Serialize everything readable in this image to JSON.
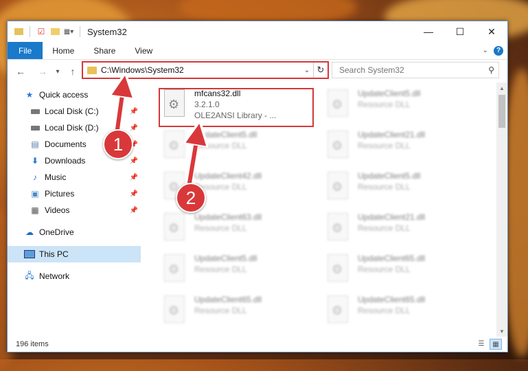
{
  "titlebar": {
    "title": "System32",
    "minimize": "—",
    "maximize": "☐",
    "close": "✕"
  },
  "ribbon": {
    "tabs": [
      "File",
      "Home",
      "Share",
      "View"
    ],
    "help": "?"
  },
  "navbar": {
    "back": "←",
    "forward": "→",
    "recent": "▾",
    "up": "↑",
    "address": "C:\\Windows\\System32",
    "search_placeholder": "Search System32"
  },
  "sidebar": {
    "items": [
      {
        "label": "Quick access",
        "icon": "star-icon"
      },
      {
        "label": "Local Disk (C:)",
        "icon": "drive-icon"
      },
      {
        "label": "Local Disk (D:)",
        "icon": "drive-icon"
      },
      {
        "label": "Documents",
        "icon": "documents-icon"
      },
      {
        "label": "Downloads",
        "icon": "download-icon"
      },
      {
        "label": "Music",
        "icon": "music-icon"
      },
      {
        "label": "Pictures",
        "icon": "pictures-icon"
      },
      {
        "label": "Videos",
        "icon": "video-icon"
      },
      {
        "label": "OneDrive",
        "icon": "cloud-icon"
      },
      {
        "label": "This PC",
        "icon": "computer-icon"
      },
      {
        "label": "Network",
        "icon": "network-icon"
      }
    ]
  },
  "files": {
    "selected": {
      "name": "mfcans32.dll",
      "version": "3.2.1.0",
      "description": "OLE2ANSI Library - ..."
    },
    "left": [
      {
        "name": "UpdateClient5.dll",
        "type": "Resource DLL"
      },
      {
        "name": "UpdateClient42.dll",
        "type": "Resource DLL"
      },
      {
        "name": "UpdateClient63.dll",
        "type": "Resource DLL"
      },
      {
        "name": "UpdateClient5.dll",
        "type": "Resource DLL"
      },
      {
        "name": "UpdateClient65.dll",
        "type": "Resource DLL"
      }
    ],
    "right": [
      {
        "name": "UpdateClient5.dll",
        "type": "Resource DLL"
      },
      {
        "name": "UpdateClient21.dll",
        "type": "Resource DLL"
      },
      {
        "name": "UpdateClient5.dll",
        "type": "Resource DLL"
      },
      {
        "name": "UpdateClient21.dll",
        "type": "Resource DLL"
      },
      {
        "name": "UpdateClient65.dll",
        "type": "Resource DLL"
      },
      {
        "name": "UpdateClient65.dll",
        "type": "Resource DLL"
      }
    ]
  },
  "status": {
    "count": "196 items"
  },
  "annotations": {
    "step1": "1",
    "step2": "2",
    "color": "#d9383a"
  }
}
